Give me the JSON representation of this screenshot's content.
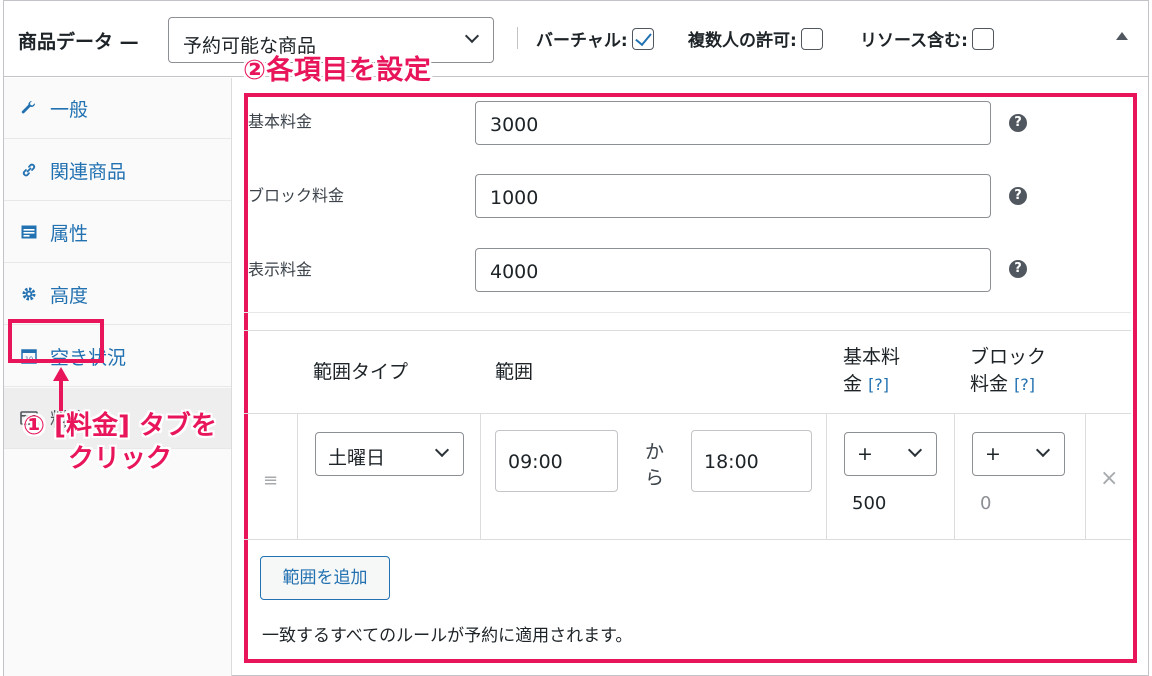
{
  "header": {
    "title": "商品データ —",
    "product_type": "予約可能な商品",
    "virtual_label": "バーチャル:",
    "virtual_checked": true,
    "multi_person_label": "複数人の許可:",
    "multi_person_checked": false,
    "resources_label": "リソース含む:",
    "resources_checked": false
  },
  "sidebar": {
    "items": [
      {
        "label": "一般",
        "icon": "wrench-icon"
      },
      {
        "label": "関連商品",
        "icon": "link-icon"
      },
      {
        "label": "属性",
        "icon": "table-icon"
      },
      {
        "label": "高度",
        "icon": "gear-icon"
      },
      {
        "label": "空き状況",
        "icon": "calendar-icon"
      },
      {
        "label": "料金",
        "icon": "card-icon",
        "active": true
      }
    ]
  },
  "annotations": {
    "step1": "① [料金] タブを",
    "step1_line2": "クリック",
    "step2": "②各項目を設定",
    "color": "#e8155a"
  },
  "fields": {
    "base_cost_label": "基本料金",
    "base_cost_value": "3000",
    "block_cost_label": "ブロック料金",
    "block_cost_value": "1000",
    "display_cost_label": "表示料金",
    "display_cost_value": "4000",
    "help_symbol": "?"
  },
  "table": {
    "headers": {
      "range_type": "範囲タイプ",
      "range": "範囲",
      "base_cost_line1": "基本料",
      "base_cost_line2": "金",
      "block_cost_line1": "ブロック",
      "block_cost_line2": "料金",
      "help_link": "[?]"
    },
    "row": {
      "drag_handle": "≡",
      "range_type": "土曜日",
      "from": "09:00",
      "between1": "か",
      "between2": "ら",
      "to": "18:00",
      "base_modifier": "+",
      "base_cost": "500",
      "block_modifier": "+",
      "block_cost": "0",
      "delete": "×"
    }
  },
  "footer": {
    "add_range_button": "範囲を追加",
    "note": "一致するすべてのルールが予約に適用されます。"
  }
}
